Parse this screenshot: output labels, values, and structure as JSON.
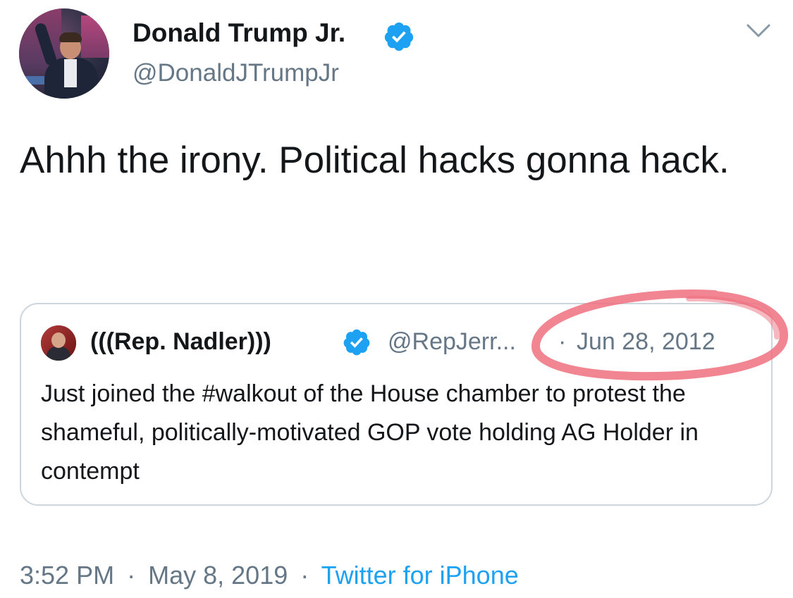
{
  "author": {
    "display_name": "Donald Trump Jr.",
    "handle": "@DonaldJTrumpJr",
    "verified": true
  },
  "tweet": {
    "text": "Ahhh the irony. Political hacks gonna hack."
  },
  "quoted_tweet": {
    "display_name": "(((Rep. Nadler)))",
    "handle": "@RepJerr...",
    "separator": "·",
    "date": "Jun 28, 2012",
    "text": "Just joined the #walkout of the House chamber to protest the shameful, politically-motivated GOP vote holding AG Holder in contempt",
    "verified": true
  },
  "footer": {
    "time": "3:52 PM",
    "sep1": "·",
    "date": "May 8, 2019",
    "sep2": "·",
    "source": "Twitter for iPhone"
  },
  "icons": {
    "verified": "verified-badge-icon",
    "menu": "chevron-down-icon"
  },
  "colors": {
    "verified_blue": "#1da1f2",
    "secondary_text": "#657786",
    "link_blue": "#1da1f2",
    "annotation_red": "#f0707f",
    "card_border": "#ccd6dd"
  }
}
